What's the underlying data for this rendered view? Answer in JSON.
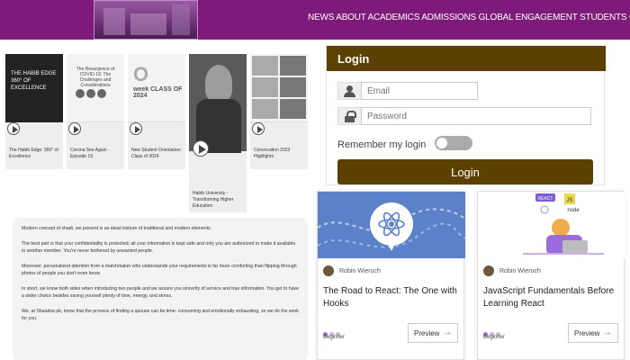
{
  "header": {
    "nav_text": "NEWS ABOUT ACADEMICS ADMISSIONS GLOBAL ENGAGEMENT STUDENTS GIVING EVENTS",
    "bg_color": "#7d1a7a"
  },
  "videos": [
    {
      "caption": "The Habib Edge: 360° of Excellence",
      "thumb_text": "THE HABIB EDGE 360° OF EXCELLENCE"
    },
    {
      "caption": "Corona See Again - Episode 19",
      "thumb_text": "The Resurgence of COVID-19: The Challenges and Considerations"
    },
    {
      "caption": "New Student Orientation: Class of 2024",
      "thumb_text_big": "O",
      "thumb_text_small": "week CLASS OF 2024"
    },
    {
      "caption": "Habib University - Transforming Higher Education"
    },
    {
      "caption": "Convocation 2023 Highlights"
    }
  ],
  "article": {
    "paragraphs": [
      "Modern concept of shadi, we present is an ideal mixture of traditional and modern elements.",
      "The best part is that your confidentiality is protected; all your information is kept safe and only you are authorized to make it available to another member. You're never bothered by unwanted people.",
      "Moreover, personalized attention from a matchmaker who understands your requirements is far more comforting than flipping through photos of people you don't even know.",
      "In short, we know both sides when introducing two people and we assure you sincerity of service and true information. You get to have a wider choice besides saving yourself plenty of time, energy, and stress.",
      "We, at Shaadee.pk, know that the process of finding a spouse can be time- consuming and emotionally exhausting, so we do the work for you."
    ]
  },
  "login": {
    "title": "Login",
    "email_placeholder": "Email",
    "password_placeholder": "Password",
    "remember_label": "Remember my login",
    "button_label": "Login",
    "accent": "#5c4000"
  },
  "cards": [
    {
      "author": "Robin Wieruch",
      "title": "The Road to React: The One with Hooks",
      "level": "Beginner",
      "preview_label": "Preview",
      "arrow": "→"
    },
    {
      "author": "Robin Wieruch",
      "title": "JavaScript Fundamentals Before Learning React",
      "level": "Beginner",
      "preview_label": "Preview",
      "arrow": "→",
      "tag_react": "REACT",
      "tag_js": "JS",
      "tag_node": "node"
    }
  ]
}
